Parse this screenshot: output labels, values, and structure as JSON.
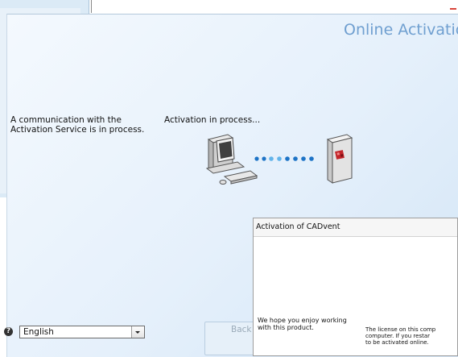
{
  "window": {
    "title": "Online Activation",
    "status_left": "A communication with the Activation Service is in process.",
    "status_mid": "Activation in process..."
  },
  "footer": {
    "language_value": "English",
    "back_label": "Back"
  },
  "dialog": {
    "title": "Activation of CADvent",
    "hope_text": "We hope you enjoy working with this product.",
    "license_lines": [
      "The license on this comp",
      "computer. If you restar",
      "to be activated online."
    ]
  },
  "colors": {
    "title": "#6f9fd0",
    "dot_dark": "#1d73c6",
    "dot_light": "#62b4ea",
    "server_red": "#c2252a"
  },
  "icons": {
    "help": "help-icon",
    "dropdown": "chevron-down-icon",
    "computer": "computer-icon",
    "server": "server-icon"
  }
}
